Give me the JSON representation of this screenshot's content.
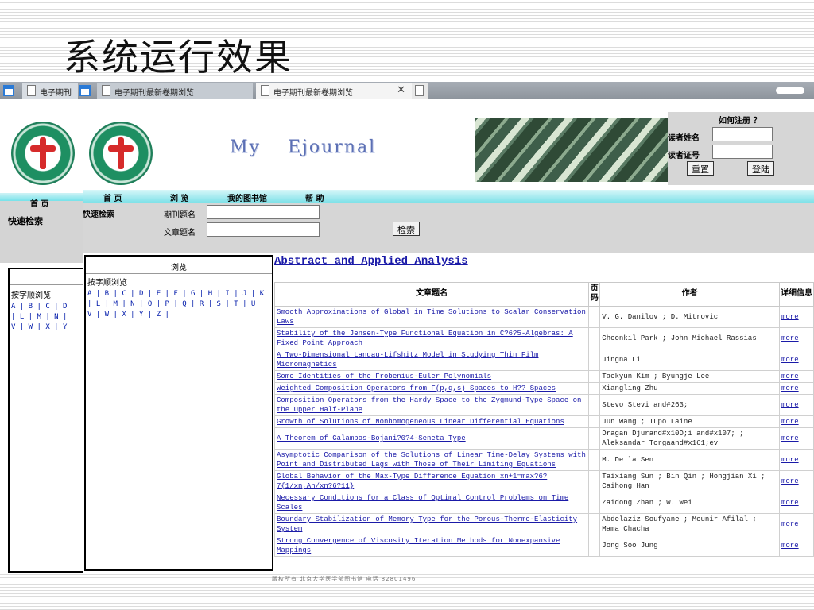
{
  "slide": {
    "title": "系统运行效果"
  },
  "browser": {
    "tabs": [
      {
        "label": "电子期刊",
        "active": false
      },
      {
        "label": "电子期刊最新卷期浏览",
        "active": false
      },
      {
        "label": "电子期刊最新卷期浏览",
        "active": true
      },
      {
        "label": "",
        "active": false
      }
    ],
    "close_glyph": "✕"
  },
  "header": {
    "brand_word1": "My",
    "brand_word2": "Ejournal"
  },
  "login": {
    "how_to_register": "如何注册 ？",
    "reader_name_label": "读者姓名",
    "reader_id_label": "读者证号",
    "reset_button": "重置",
    "login_button": "登陆"
  },
  "left_frame": {
    "home": "首  页",
    "quick_search": "快速检索",
    "by_letter": "按字顺浏览",
    "letters_line1": "A | B | C | D",
    "letters_line2": "| L | M | N |",
    "letters_line3": "V | W | X | Y"
  },
  "nav": {
    "items": [
      "首  页",
      "浏  览",
      "我的图书馆",
      "帮  助"
    ]
  },
  "search": {
    "label": "快速检索",
    "journal_label": "期刊题名",
    "article_label": "文章题名",
    "button": "检索"
  },
  "browse": {
    "header": "浏览",
    "sub": "按字顺浏览",
    "line1": "A | B | C | D | E | F | G | H | I | J | K",
    "line2": "| L | M | N | O | P | Q | R | S | T | U |",
    "line3": "V | W | X | Y | Z |"
  },
  "journal": {
    "name": "Abstract and Applied Analysis"
  },
  "table": {
    "headers": {
      "title": "文章题名",
      "page": "页码",
      "author": "作者",
      "detail": "详细信息"
    },
    "rows": [
      {
        "title": "Smooth Approximations of Global in Time Solutions to Scalar Conservation Laws",
        "author": "V. G. Danilov ; D. Mitrovic",
        "more": "more"
      },
      {
        "title": "Stability of the Jensen-Type Functional Equation in C?6?5-Algebras: A Fixed Point Approach",
        "author": "Choonkil Park ; John Michael Rassias",
        "more": "more"
      },
      {
        "title": "A Two-Dimensional Landau-Lifshitz Model in Studying Thin Film Micromagnetics",
        "author": "Jingna Li",
        "more": "more"
      },
      {
        "title": "Some Identities of the Frobenius-Euler Polynomials",
        "author": "Taekyun Kim ; Byungje Lee",
        "more": "more"
      },
      {
        "title": "Weighted Composition Operators from F(p,q,s) Spaces to H?? Spaces",
        "author": "Xiangling Zhu",
        "more": "more"
      },
      {
        "title": "Composition Operators from the Hardy Space to the Zygmund-Type Space on the Upper Half-Plane",
        "author": "Stevo Stevi and#263;",
        "more": "more"
      },
      {
        "title": "Growth of Solutions of Nonhomogeneous Linear Differential Equations",
        "author": "Jun Wang ; ILpo Laine",
        "more": "more"
      },
      {
        "title": "A Theorem of Galambos-Bojani?0?4-Seneta Type",
        "author": "Dragan Djurand#x10D;i and#x107; ; Aleksandar Torgaand#x161;ev",
        "more": "more"
      },
      {
        "title": "Asymptotic Comparison of the Solutions of Linear Time-Delay Systems with Point and Distributed Lags with Those of Their Limiting Equations",
        "author": "M. De la Sen",
        "more": "more"
      },
      {
        "title": "Global Behavior of the Max-Type Difference Equation xn+1=max?6?7{1/xn,An/xn?6?11}",
        "author": "Taixiang Sun ; Bin Qin ; Hongjian Xi ; Caihong Han",
        "more": "more"
      },
      {
        "title": "Necessary Conditions for a Class of Optimal Control Problems on Time Scales",
        "author": "Zaidong Zhan ; W. Wei",
        "more": "more"
      },
      {
        "title": "Boundary Stabilization of Memory Type for the Porous-Thermo-Elasticity System",
        "author": "Abdelaziz Soufyane ; Mounir Afilal ; Mama Chacha",
        "more": "more"
      },
      {
        "title": "Strong Convergence of Viscosity Iteration Methods for Nonexpansive Mappings",
        "author": "Jong Soo Jung",
        "more": "more"
      }
    ]
  },
  "footer": {
    "text": "版权所有  北京大学医学部图书馆  电话  82801496"
  }
}
